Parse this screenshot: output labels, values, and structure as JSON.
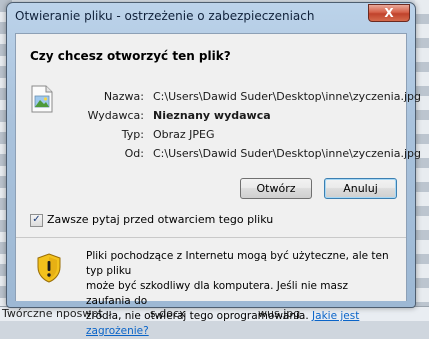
{
  "background": {
    "bottom_left": "Twórczne nposwpt",
    "bottom_mid": "s.docx",
    "bottom_right": "wus.jpg"
  },
  "window": {
    "title": "Otwieranie pliku - ostrzeżenie o zabezpieczeniach",
    "close_glyph": "X"
  },
  "dialog": {
    "question": "Czy chcesz otworzyć ten plik?",
    "fields": [
      {
        "label": "Nazwa:",
        "value": "C:\\Users\\Dawid Suder\\Desktop\\inne\\zyczenia.jpg",
        "bold": false
      },
      {
        "label": "Wydawca:",
        "value": "Nieznany wydawca",
        "bold": true
      },
      {
        "label": "Typ:",
        "value": "Obraz JPEG",
        "bold": false
      },
      {
        "label": "Od:",
        "value": "C:\\Users\\Dawid Suder\\Desktop\\inne\\zyczenia.jpg",
        "bold": false
      }
    ],
    "buttons": {
      "open": "Otwórz",
      "cancel": "Anuluj"
    },
    "checkbox": {
      "label": "Zawsze pytaj przed otwarciem tego pliku",
      "checked": true,
      "check_glyph": "✓"
    },
    "warning": {
      "line1": "Pliki pochodzące z Internetu mogą być użyteczne, ale ten typ pliku",
      "line2": "może być szkodliwy dla komputera. Jeśli nie masz zaufania do",
      "line3": "źródła, nie otwieraj tego oprogramowania.",
      "link": "Jakie jest zagrożenie?"
    }
  },
  "colors": {
    "link": "#0a64c8",
    "titlebar": "#a9c2dc",
    "close": "#c0432c"
  },
  "icons": [
    "image-file-icon",
    "security-shield-icon",
    "close-icon"
  ]
}
